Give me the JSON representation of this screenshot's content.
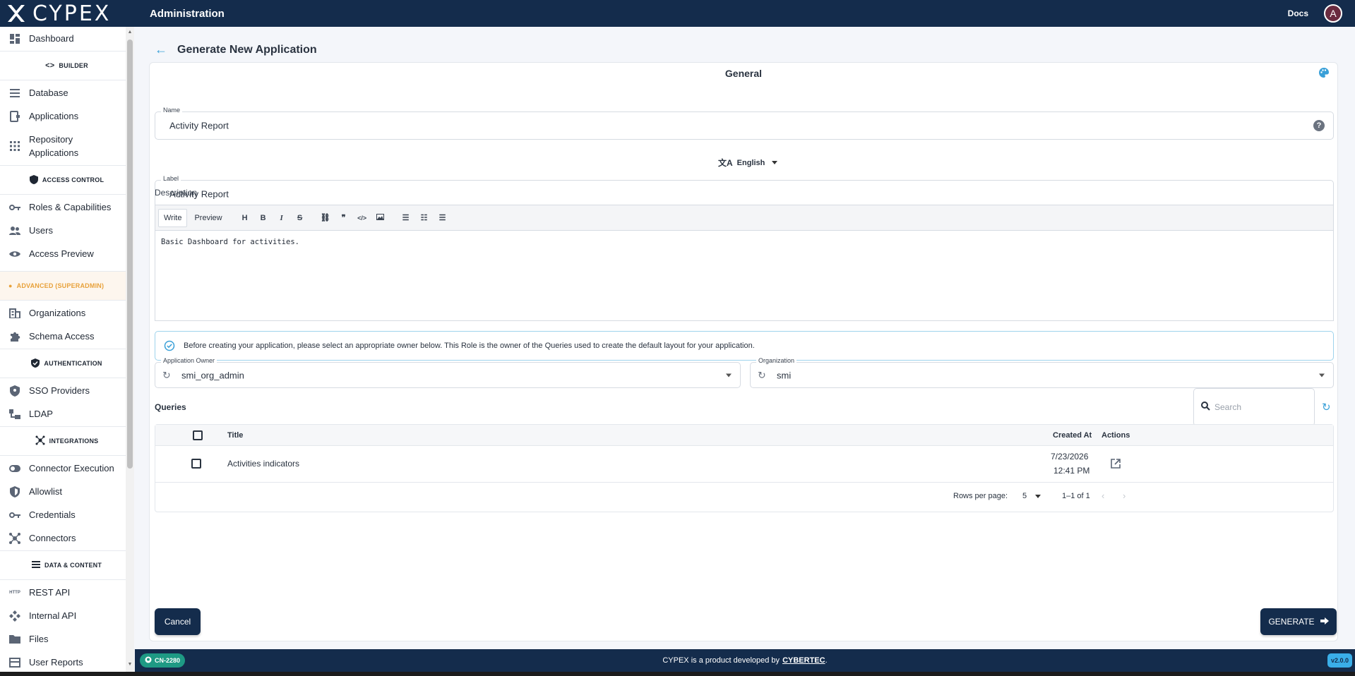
{
  "app": {
    "logo_text": "CYPEX",
    "header_title": "Administration",
    "docs_label": "Docs",
    "avatar_letter": "A"
  },
  "sidebar": {
    "dashboard": "Dashboard",
    "builder_section": "BUILDER",
    "database": "Database",
    "applications": "Applications",
    "repository_applications": "Repository Applications",
    "access_control_section": "ACCESS CONTROL",
    "roles_capabilities": "Roles & Capabilities",
    "users": "Users",
    "access_preview": "Access Preview",
    "advanced_section": "ADVANCED (SUPERADMIN)",
    "organizations": "Organizations",
    "schema_access": "Schema Access",
    "authentication_section": "AUTHENTICATION",
    "sso_providers": "SSO Providers",
    "ldap": "LDAP",
    "integrations_section": "INTEGRATIONS",
    "connector_execution": "Connector Execution",
    "allowlist": "Allowlist",
    "credentials": "Credentials",
    "connectors": "Connectors",
    "data_content_section": "DATA & CONTENT",
    "rest_api": "REST API",
    "internal_api": "Internal API",
    "files": "Files",
    "user_reports": "User Reports",
    "http_badge": "HTTP"
  },
  "page": {
    "title": "Generate New Application",
    "section_title": "General"
  },
  "form": {
    "name_label": "Name",
    "name_value": "Activity Report",
    "language": "English",
    "label_label": "Label",
    "label_value": "Activity Report",
    "description_label": "Description",
    "editor": {
      "write_tab": "Write",
      "preview_tab": "Preview",
      "heading": "H",
      "bold": "B",
      "italic": "I",
      "strike": "S",
      "content": "Basic Dashboard for activities."
    },
    "info_text": "Before creating your application, please select an appropriate owner below. This Role is the owner of the Queries used to create the default layout for your application.",
    "owner_label": "Application Owner",
    "owner_value": "smi_org_admin",
    "org_label": "Organization",
    "org_value": "smi"
  },
  "queries": {
    "title": "Queries",
    "search_placeholder": "Search",
    "columns": {
      "title": "Title",
      "created_at": "Created At",
      "actions": "Actions"
    },
    "rows": [
      {
        "title": "Activities indicators",
        "created_date": "7/23/2026",
        "created_time": "12:41 PM"
      }
    ],
    "rows_per_page_label": "Rows per page:",
    "rows_per_page": "5",
    "range": "1–1 of 1"
  },
  "actions": {
    "cancel": "Cancel",
    "generate": "GENERATE"
  },
  "footer": {
    "branch": "CN-2280",
    "text": "CYPEX is a product developed by",
    "company": "CYBERTEC",
    "period": ".",
    "version": "v2.0.0"
  },
  "colors": {
    "navy": "#142c4c",
    "accent": "#3aa0d8",
    "advanced": "#e8a13a",
    "branch_chip": "#1e9a84"
  }
}
